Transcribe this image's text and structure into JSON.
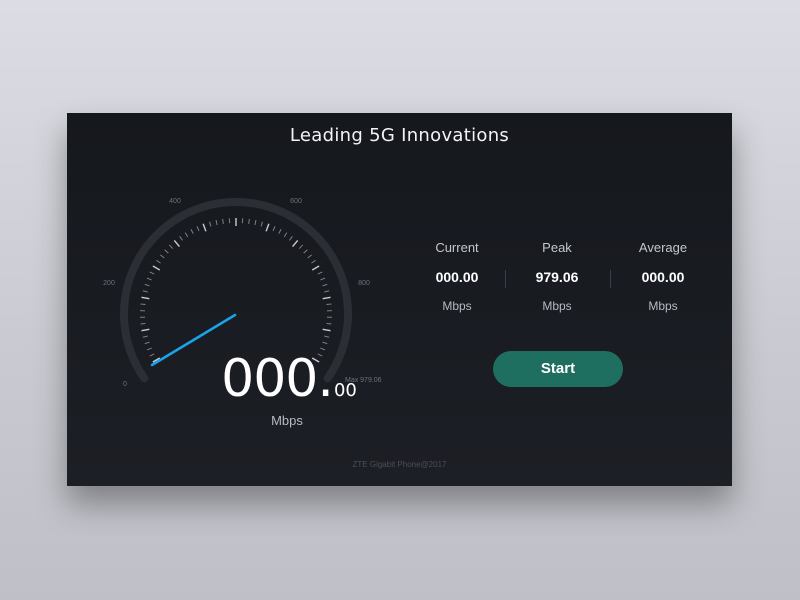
{
  "title": "Leading 5G Innovations",
  "gauge": {
    "scale_labels": [
      "0",
      "200",
      "400",
      "600",
      "800"
    ],
    "max_label": "Max 979.06",
    "value_int": "000",
    "value_dot": ".",
    "value_dec": "00",
    "unit": "Mbps",
    "needle_color": "#1aa3e8"
  },
  "stats": [
    {
      "label": "Current",
      "value": "000.00",
      "unit": "Mbps"
    },
    {
      "label": "Peak",
      "value": "979.06",
      "unit": "Mbps"
    },
    {
      "label": "Average",
      "value": "000.00",
      "unit": "Mbps"
    }
  ],
  "start_button": {
    "label": "Start",
    "color": "#1e6f5f"
  },
  "footer": "ZTE Gigabit Phone@2017"
}
